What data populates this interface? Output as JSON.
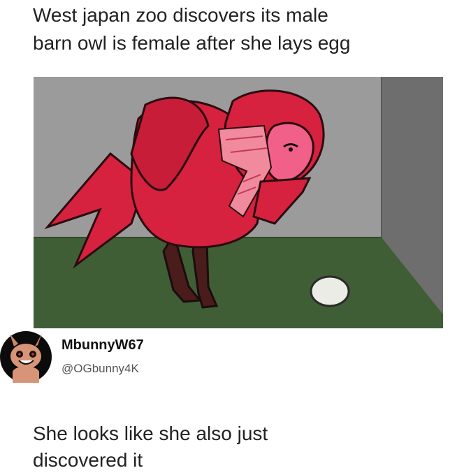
{
  "post": {
    "headline": "West japan zoo discovers its male\nbarn owl is female after she lays egg"
  },
  "image": {
    "icon": "cartoon-owl-with-egg"
  },
  "reply": {
    "username": "MbunnyW67",
    "handle": "@OGbunny4K",
    "text": "She looks like she also just\ndiscovered it",
    "avatar_icon": "bunny-avatar"
  }
}
